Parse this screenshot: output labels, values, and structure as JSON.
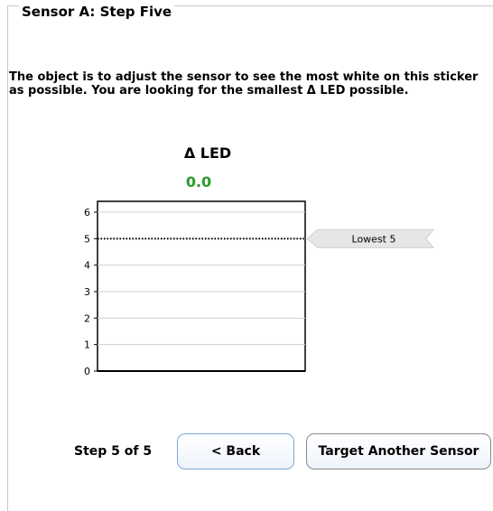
{
  "group": {
    "title": "Sensor A: Step Five"
  },
  "instructions": "The object is to adjust the sensor to see the most white on this sticker as possible.  You are looking for the smallest Δ LED possible.",
  "metric": {
    "title": "Δ LED",
    "value": "0.0",
    "value_color": "#2a9a2a"
  },
  "chart_data": {
    "type": "bar",
    "categories": [
      ""
    ],
    "values": [
      0.0
    ],
    "ylim": [
      0,
      6
    ],
    "y_ticks": [
      "0",
      "1",
      "2",
      "3",
      "4",
      "5",
      "6"
    ],
    "grid": true,
    "reference_line": {
      "y": 5,
      "label": "Lowest 5"
    }
  },
  "footer": {
    "step_label": "Step 5 of 5",
    "back_label": "< Back",
    "target_label": "Target Another Sensor"
  }
}
